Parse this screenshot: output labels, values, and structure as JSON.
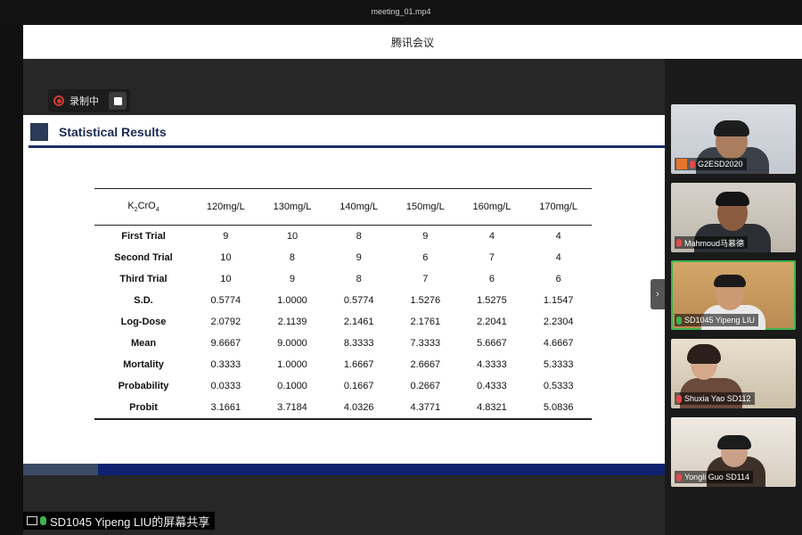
{
  "window": {
    "filename": "meeting_01.mp4",
    "app_title": "腾讯会议"
  },
  "recording": {
    "label": "录制中"
  },
  "slide": {
    "title": "Statistical Results",
    "table": {
      "header_prefix": "K",
      "header_sub1": "2",
      "header_mid": "CrO",
      "header_sub2": "4",
      "columns": [
        "120mg/L",
        "130mg/L",
        "140mg/L",
        "150mg/L",
        "160mg/L",
        "170mg/L"
      ],
      "rows": [
        {
          "label": "First Trial",
          "values": [
            "9",
            "10",
            "8",
            "9",
            "4",
            "4"
          ]
        },
        {
          "label": "Second Trial",
          "values": [
            "10",
            "8",
            "9",
            "6",
            "7",
            "4"
          ]
        },
        {
          "label": "Third Trial",
          "values": [
            "10",
            "9",
            "8",
            "7",
            "6",
            "6"
          ]
        },
        {
          "label": "S.D.",
          "values": [
            "0.5774",
            "1.0000",
            "0.5774",
            "1.5276",
            "1.5275",
            "1.1547"
          ]
        },
        {
          "label": "Log-Dose",
          "values": [
            "2.0792",
            "2.1139",
            "2.1461",
            "2.1761",
            "2.2041",
            "2.2304"
          ]
        },
        {
          "label": "Mean",
          "values": [
            "9.6667",
            "9.0000",
            "8.3333",
            "7.3333",
            "5.6667",
            "4.6667"
          ]
        },
        {
          "label": "Mortality",
          "values": [
            "0.3333",
            "1.0000",
            "1.6667",
            "2.6667",
            "4.3333",
            "5.3333"
          ]
        },
        {
          "label": "Probability",
          "values": [
            "0.0333",
            "0.1000",
            "0.1667",
            "0.2667",
            "0.4333",
            "0.5333"
          ]
        },
        {
          "label": "Probit",
          "values": [
            "3.1661",
            "3.7184",
            "4.0326",
            "4.3771",
            "4.8321",
            "5.0836"
          ]
        }
      ]
    }
  },
  "participants": [
    {
      "name": "G2ESD2020"
    },
    {
      "name": "Mahmoud马慕德"
    },
    {
      "name": "SD1045 Yipeng LIU"
    },
    {
      "name": "Shuxia Yao SD112"
    },
    {
      "name": "Yongli Guo SD114"
    }
  ],
  "screen_share": {
    "label": "SD1045 Yipeng LIU的屏幕共享"
  },
  "colors": {
    "slide_accent": "#1a2f6c",
    "speaking_border": "#3fb34f",
    "record_red": "#d13a2f"
  },
  "icons": {
    "collapse": "›"
  }
}
